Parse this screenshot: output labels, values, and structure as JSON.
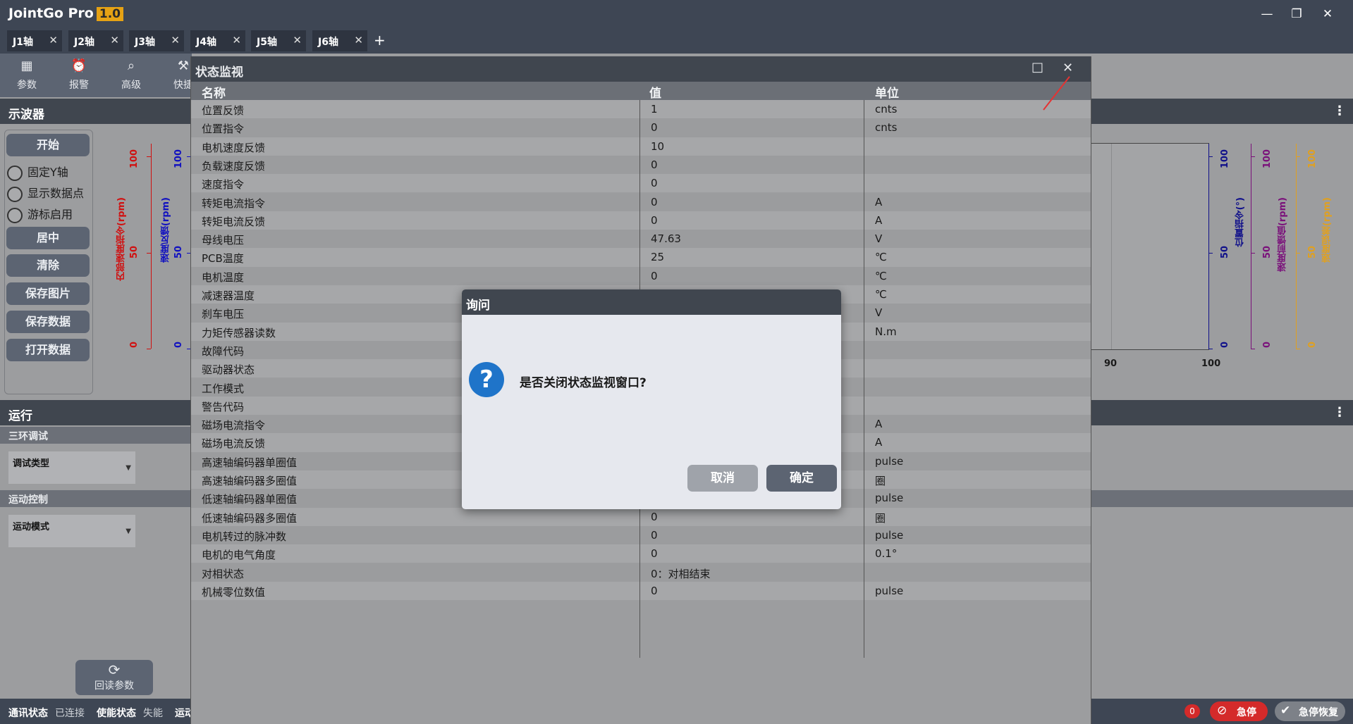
{
  "app": {
    "title": "JointGo Pro",
    "version": "1.0"
  },
  "tabs": [
    "J1轴",
    "J2轴",
    "J3轴",
    "J4轴",
    "J5轴",
    "J6轴"
  ],
  "toolbar": [
    {
      "label": "参数",
      "icon": "grid-icon"
    },
    {
      "label": "报警",
      "icon": "alarm-icon"
    },
    {
      "label": "高级",
      "icon": "search-icon"
    },
    {
      "label": "快捷",
      "icon": "wrench-icon"
    }
  ],
  "oscilloscope": {
    "header": "示波器",
    "buttons": {
      "start": "开始",
      "center": "居中",
      "clear": "清除",
      "save_image": "保存图片",
      "save_data": "保存数据",
      "open_data": "打开数据"
    },
    "checkboxes": {
      "fix_y": "固定Y轴",
      "show_points": "显示数据点",
      "cursor": "游标启用"
    },
    "left_axes": [
      {
        "label": "内部速度指令(rpm)",
        "color": "#d01010",
        "ticks": [
          "100",
          "50",
          "0"
        ]
      },
      {
        "label": "速度反馈(rpm)",
        "color": "#1010c0",
        "ticks": [
          "100",
          "50",
          "0"
        ]
      }
    ],
    "right_axes": [
      {
        "label": "位置指令(°)",
        "color": "#10108a",
        "ticks": [
          "100",
          "50",
          "0"
        ]
      },
      {
        "label": "速度前馈值(rpm)",
        "color": "#7a107a",
        "ticks": [
          "100",
          "50",
          "0"
        ]
      },
      {
        "label": "速度误差(rpm)",
        "color": "#e0a020",
        "ticks": [
          "100",
          "50",
          "0"
        ]
      }
    ],
    "x_ticks": [
      "90",
      "100"
    ]
  },
  "run": {
    "header": "运行",
    "three_loop": {
      "title": "三环调试",
      "combo_label": "调试类型"
    },
    "motion": {
      "title": "运动控制",
      "combo_label": "运动模式"
    },
    "readback_label": "回读参数"
  },
  "statusbar": {
    "comm_label": "通讯状态",
    "comm_value": "已连接",
    "enable_label": "使能状态",
    "enable_value": "失能",
    "run_label": "运动",
    "alarm_count": "0",
    "estop_label": "急停",
    "estop_reset_label": "急停恢复"
  },
  "monitor": {
    "title": "状态监视",
    "columns": [
      "名称",
      "值",
      "单位"
    ],
    "rows": [
      [
        "位置反馈",
        "1",
        "cnts"
      ],
      [
        "位置指令",
        "0",
        "cnts"
      ],
      [
        "电机速度反馈",
        "10",
        ""
      ],
      [
        "负载速度反馈",
        "0",
        ""
      ],
      [
        "速度指令",
        "0",
        ""
      ],
      [
        "转矩电流指令",
        "0",
        "A"
      ],
      [
        "转矩电流反馈",
        "0",
        "A"
      ],
      [
        "母线电压",
        "47.63",
        "V"
      ],
      [
        "PCB温度",
        "25",
        "℃"
      ],
      [
        "电机温度",
        "0",
        "℃"
      ],
      [
        "减速器温度",
        "",
        "℃"
      ],
      [
        "刹车电压",
        "",
        "V"
      ],
      [
        "力矩传感器读数",
        "",
        "N.m"
      ],
      [
        "故障代码",
        "",
        ""
      ],
      [
        "驱动器状态",
        "",
        ""
      ],
      [
        "工作模式",
        "",
        ""
      ],
      [
        "警告代码",
        "",
        ""
      ],
      [
        "磁场电流指令",
        "",
        "A"
      ],
      [
        "磁场电流反馈",
        "",
        "A"
      ],
      [
        "高速轴编码器单圈值",
        "",
        "pulse"
      ],
      [
        "高速轴编码器多圈值",
        "",
        "圈"
      ],
      [
        "低速轴编码器单圈值",
        "",
        "pulse"
      ],
      [
        "低速轴编码器多圈值",
        "0",
        "圈"
      ],
      [
        "电机转过的脉冲数",
        "0",
        "pulse"
      ],
      [
        "电机的电气角度",
        "0",
        "0.1°"
      ],
      [
        "对相状态",
        "0：对相结束",
        ""
      ],
      [
        "机械零位数值",
        "0",
        "pulse"
      ]
    ]
  },
  "dialog": {
    "title": "询问",
    "message": "是否关闭状态监视窗口?",
    "cancel": "取消",
    "ok": "确定",
    "icon": "question-icon"
  },
  "colors": {
    "header": "#40464f",
    "button": "#5c6472",
    "accent": "#e6a214",
    "danger": "#d42a2a"
  }
}
